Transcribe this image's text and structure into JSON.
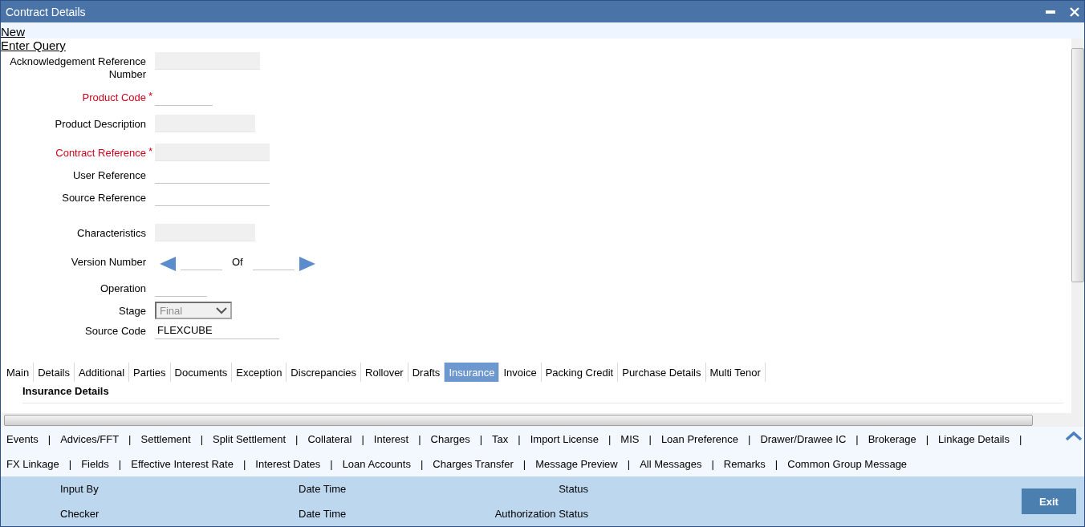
{
  "window": {
    "title": "Contract Details"
  },
  "toolbar": {
    "links": [
      "New",
      "Enter Query"
    ]
  },
  "form": {
    "fields": [
      {
        "label": "Acknowledgement Reference Number",
        "kind": "text",
        "required": false,
        "readonly": true
      },
      {
        "label": "Product Code",
        "kind": "text",
        "required": true,
        "required_mark": "*",
        "readonly": false
      },
      {
        "label": "Product Description",
        "kind": "text",
        "required": false,
        "readonly": true
      },
      {
        "label": "Contract Reference",
        "kind": "text",
        "required": true,
        "required_mark": "*",
        "readonly": true
      },
      {
        "label": "User Reference",
        "kind": "text",
        "required": false,
        "readonly": false
      },
      {
        "label": "Source Reference",
        "kind": "text",
        "required": false,
        "readonly": false
      },
      {
        "label": "Characteristics",
        "kind": "text",
        "required": false,
        "readonly": true
      },
      {
        "label": "Version Number",
        "kind": "version",
        "required": false,
        "of_label": "Of"
      },
      {
        "label": "Operation",
        "kind": "text",
        "required": false,
        "readonly": false
      },
      {
        "label": "Stage",
        "kind": "select",
        "required": false,
        "value": "Final",
        "disabled": true
      },
      {
        "label": "Source Code",
        "kind": "text",
        "required": false,
        "readonly": false,
        "value": "FLEXCUBE"
      }
    ]
  },
  "tabs": [
    {
      "label": "Main",
      "selected": false
    },
    {
      "label": "Details",
      "selected": false
    },
    {
      "label": "Additional",
      "selected": false
    },
    {
      "label": "Parties",
      "selected": false
    },
    {
      "label": "Documents",
      "selected": false
    },
    {
      "label": "Exception",
      "selected": false
    },
    {
      "label": "Discrepancies",
      "selected": false
    },
    {
      "label": "Rollover",
      "selected": false
    },
    {
      "label": "Drafts",
      "selected": false
    },
    {
      "label": "Insurance",
      "selected": true
    },
    {
      "label": "Invoice",
      "selected": false
    },
    {
      "label": "Packing Credit",
      "selected": false
    },
    {
      "label": "Purchase Details",
      "selected": false
    },
    {
      "label": "Multi Tenor",
      "selected": false
    }
  ],
  "section": {
    "title": "Insurance Details"
  },
  "link_rows": [
    [
      {
        "label": "Events",
        "sep": "|"
      },
      {
        "label": "Advices/FFT",
        "sep": "|"
      },
      {
        "label": "Settlement",
        "sep": "|"
      },
      {
        "label": "Split Settlement",
        "sep": "|"
      },
      {
        "label": "Collateral",
        "sep": "|"
      },
      {
        "label": "Interest",
        "sep": "|"
      },
      {
        "label": "Charges",
        "sep": "|"
      },
      {
        "label": "Tax",
        "sep": "|"
      },
      {
        "label": "Import License",
        "sep": "|"
      },
      {
        "label": "MIS",
        "sep": "|"
      },
      {
        "label": "Loan Preference",
        "sep": "|"
      },
      {
        "label": "Drawer/Drawee IC",
        "sep": "|"
      },
      {
        "label": "Brokerage",
        "sep": "|"
      },
      {
        "label": "Linkage Details",
        "sep": "|"
      }
    ],
    [
      {
        "label": "FX Linkage",
        "sep": "|"
      },
      {
        "label": "Fields",
        "sep": "|"
      },
      {
        "label": "Effective Interest Rate",
        "sep": "|"
      },
      {
        "label": "Interest Dates",
        "sep": "|"
      },
      {
        "label": "Loan Accounts",
        "sep": "|"
      },
      {
        "label": "Charges Transfer",
        "sep": "|"
      },
      {
        "label": "Message Preview",
        "sep": "|"
      },
      {
        "label": "All Messages",
        "sep": "|"
      },
      {
        "label": "Remarks",
        "sep": "|"
      },
      {
        "label": "Common Group Message"
      }
    ]
  ],
  "footer": {
    "rows": [
      [
        "Input By",
        "Date Time",
        "Status"
      ],
      [
        "Checker",
        "Date Time",
        "Authorization Status"
      ]
    ],
    "button": "Exit"
  }
}
